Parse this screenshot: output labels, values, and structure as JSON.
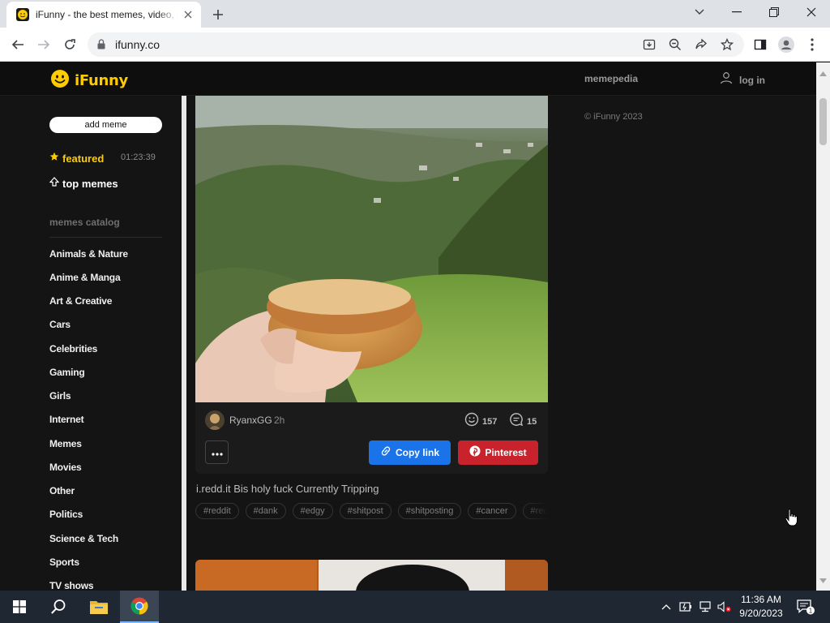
{
  "browser": {
    "tab_title": "iFunny - the best memes, video, gifs",
    "url": "ifunny.co",
    "icons": [
      "back-icon",
      "forward-icon",
      "reload-icon",
      "lock-icon",
      "install-icon",
      "zoom-icon",
      "share-icon",
      "star-icon",
      "side-panel-icon",
      "profile-icon",
      "menu-icon"
    ]
  },
  "header": {
    "logo_text": "iFunny",
    "memepedia": "memepedia",
    "login": "log in"
  },
  "sidebar": {
    "add_meme": "add meme",
    "featured": "featured",
    "featured_time": "01:23:39",
    "top_memes": "top memes",
    "catalog_title": "memes catalog",
    "categories": [
      "Animals & Nature",
      "Anime & Manga",
      "Art & Creative",
      "Cars",
      "Celebrities",
      "Gaming",
      "Girls",
      "Internet",
      "Memes",
      "Movies",
      "Other",
      "Politics",
      "Science & Tech",
      "Sports",
      "TV shows"
    ]
  },
  "post": {
    "author": "RyanxGG",
    "time": "2h",
    "smiles": "157",
    "comments": "15",
    "copy_link": "Copy link",
    "pinterest": "Pinterest",
    "caption": "i.redd.it Bis holy fuck Currently Tripping",
    "tags": [
      "#reddit",
      "#dank",
      "#edgy",
      "#shitpost",
      "#shitposting",
      "#cancer",
      "#reddit"
    ]
  },
  "right_column": {
    "copyright": "© iFunny 2023"
  },
  "taskbar": {
    "time": "11:36 AM",
    "date": "9/20/2023",
    "notification_count": "1"
  },
  "colors": {
    "accent": "#ffcc00",
    "copy_link_bg": "#1a73e8",
    "pinterest_bg": "#c8232c",
    "page_bg": "#141414"
  }
}
